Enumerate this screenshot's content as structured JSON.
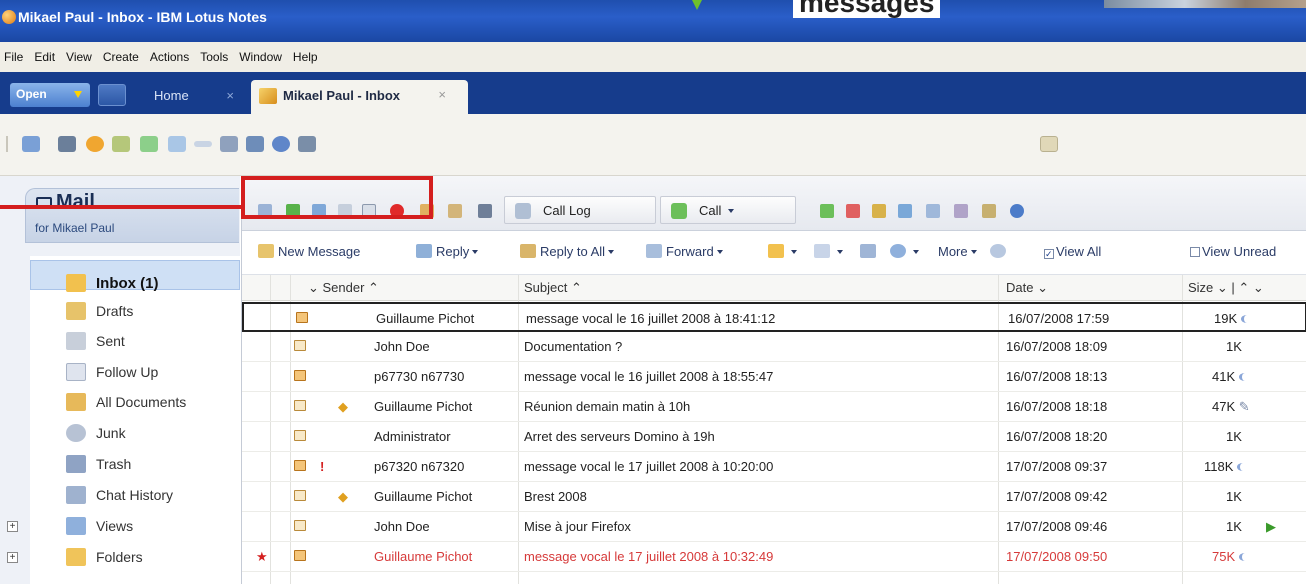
{
  "window": {
    "title": "Mikael Paul - Inbox - IBM Lotus Notes",
    "overlay_heading": "messages"
  },
  "menu": [
    "File",
    "Edit",
    "View",
    "Create",
    "Actions",
    "Tools",
    "Window",
    "Help"
  ],
  "tabs": {
    "open_label": "Open",
    "home_label": "Home",
    "home_close": "×",
    "inbox_label": "Mikael Paul - Inbox",
    "inbox_close": "×"
  },
  "sidebar": {
    "title": "Mail",
    "owner": "for Mikael Paul",
    "items": [
      {
        "label": "Inbox (1)",
        "icon": "inbox-icon",
        "active": true
      },
      {
        "label": "Drafts",
        "icon": "drafts-icon"
      },
      {
        "label": "Sent",
        "icon": "sent-icon"
      },
      {
        "label": "Follow Up",
        "icon": "follow-up-flag-icon"
      },
      {
        "label": "All Documents",
        "icon": "all-documents-icon"
      },
      {
        "label": "Junk",
        "icon": "junk-icon"
      },
      {
        "label": "Trash",
        "icon": "trash-icon"
      },
      {
        "label": "Chat History",
        "icon": "chat-history-icon"
      },
      {
        "label": "Views",
        "icon": "views-icon",
        "expander": "+"
      },
      {
        "label": "Folders",
        "icon": "folders-icon",
        "expander": "+"
      }
    ]
  },
  "action_bar": {
    "call_log": "Call Log",
    "call": "Call"
  },
  "message_bar": {
    "new_message": "New Message",
    "reply": "Reply",
    "reply_all": "Reply to All",
    "forward": "Forward",
    "more": "More",
    "view_all": "View All",
    "view_unread": "View Unread",
    "view_all_checked": true
  },
  "table": {
    "headers": {
      "sender": "Sender",
      "subject": "Subject",
      "date": "Date",
      "size": "Size"
    },
    "rows": [
      {
        "sender": "Guillaume Pichot",
        "subject": "message vocal le 16 juillet 2008 à 18:41:12",
        "date": "16/07/2008 17:59",
        "size": "19K",
        "voice": true,
        "selected": true
      },
      {
        "sender": "John Doe",
        "subject": "Documentation ?",
        "date": "16/07/2008 18:09",
        "size": "1K"
      },
      {
        "sender": "p67730 n67730",
        "subject": "message vocal le 16 juillet 2008 à 18:55:47",
        "date": "16/07/2008 18:13",
        "size": "41K",
        "voice": true
      },
      {
        "sender": "Guillaume Pichot",
        "subject": "Réunion demain matin à 10h",
        "date": "16/07/2008 18:18",
        "size": "47K",
        "marker": "◆",
        "attachment": true
      },
      {
        "sender": "Administrator",
        "subject": "Arret des serveurs Domino à 19h",
        "date": "16/07/2008 18:20",
        "size": "1K"
      },
      {
        "sender": "p67320 n67320",
        "subject": "message vocal le 17 juillet 2008 à 10:20:00",
        "date": "17/07/2008 09:37",
        "size": "118K",
        "voice": true,
        "priority": "!"
      },
      {
        "sender": "Guillaume Pichot",
        "subject": "Brest 2008",
        "date": "17/07/2008 09:42",
        "size": "1K",
        "marker": "◆"
      },
      {
        "sender": "John Doe",
        "subject": "Mise à jour Firefox",
        "date": "17/07/2008 09:46",
        "size": "1K",
        "flag": "▶"
      },
      {
        "sender": "Guillaume Pichot",
        "subject": "message vocal le 17 juillet 2008 à 10:32:49",
        "date": "17/07/2008 09:50",
        "size": "75K",
        "voice": true,
        "unread": "★",
        "urgent": true
      }
    ]
  },
  "colors": {
    "title_bar": "#1f4fae",
    "tab_bar": "#163c8c",
    "annotation": "#d41e1e",
    "urgent_text": "#d63a3a"
  }
}
